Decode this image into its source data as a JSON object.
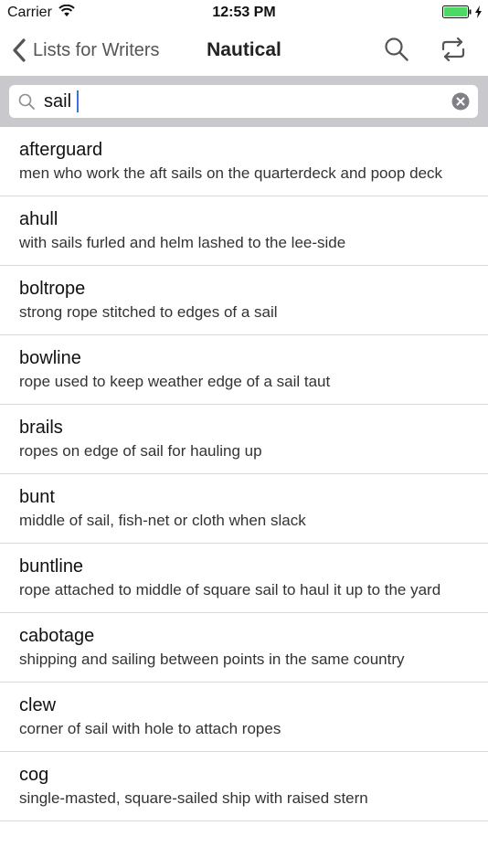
{
  "status_bar": {
    "carrier": "Carrier",
    "time": "12:53 PM",
    "battery_color": "#4cd964"
  },
  "nav": {
    "back_label": "Lists for Writers",
    "title": "Nautical",
    "search_icon": "search-icon",
    "shuffle_icon": "shuffle-icon"
  },
  "search": {
    "value": "sail",
    "placeholder": ""
  },
  "results": [
    {
      "term": "afterguard",
      "definition": "men who work the aft sails on the quarterdeck and poop deck"
    },
    {
      "term": "ahull",
      "definition": "with sails furled and helm lashed to the lee-side"
    },
    {
      "term": "boltrope",
      "definition": "strong rope stitched to edges of a sail"
    },
    {
      "term": "bowline",
      "definition": "rope used to keep weather edge of a sail taut"
    },
    {
      "term": "brails",
      "definition": "ropes on edge of sail for hauling up"
    },
    {
      "term": "bunt",
      "definition": "middle of sail, fish-net or cloth when slack"
    },
    {
      "term": "buntline",
      "definition": "rope attached to middle of square sail to haul it up to the yard"
    },
    {
      "term": "cabotage",
      "definition": "shipping and sailing between points in the same country"
    },
    {
      "term": "clew",
      "definition": "corner of sail with hole to attach ropes"
    },
    {
      "term": "cog",
      "definition": "single-masted, square-sailed ship with raised stern"
    }
  ]
}
